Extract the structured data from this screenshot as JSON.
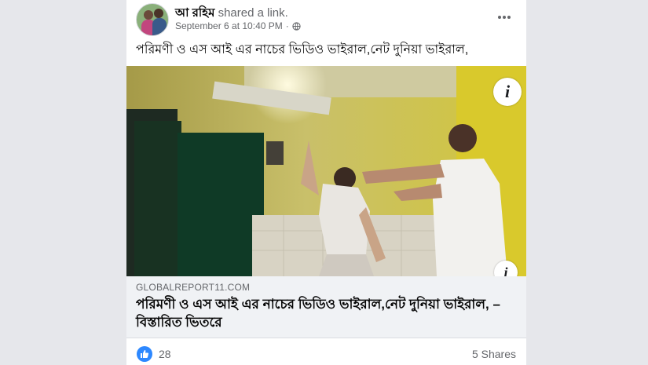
{
  "post": {
    "author": "আ রহিম",
    "action": "shared a link.",
    "timestamp": "September 6 at 10:40 PM",
    "privacy_icon": "globe-icon",
    "more_icon": "more-horizontal-icon",
    "text": "পরিমণী ও এস আই এর নাচের ভিডিও ভাইরাল,নেট দুনিয়া ভাইরাল,"
  },
  "media": {
    "info_icon": "info-icon",
    "info_label": "i"
  },
  "link": {
    "domain": "GLOBALREPORT11.COM",
    "title": "পরিমণী ও এস আই এর নাচের ভিডিও ভাইরাল,নেট দুনিয়া ভাইরাল, – বিস্তারিত ভিতরে"
  },
  "footer": {
    "like_icon": "like-icon",
    "like_count": "28",
    "shares": "5 Shares"
  },
  "colors": {
    "accent": "#2d88ff",
    "secondary_text": "#65676b",
    "page_bg": "#e6e7eb"
  }
}
